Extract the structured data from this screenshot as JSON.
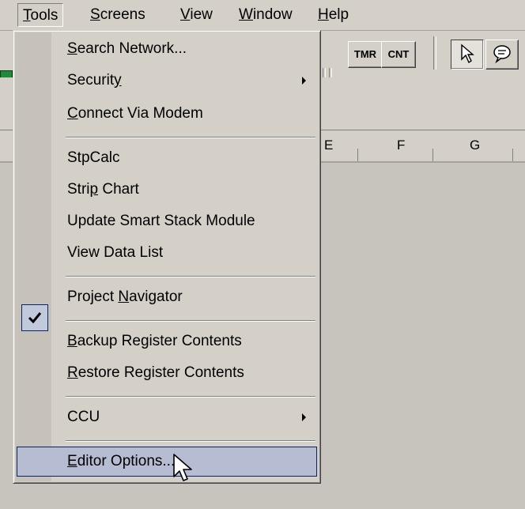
{
  "menubar": {
    "items": [
      {
        "pre": "",
        "u": "T",
        "post": "ools"
      },
      {
        "pre": "",
        "u": "S",
        "post": "creens"
      },
      {
        "pre": "",
        "u": "V",
        "post": "iew"
      },
      {
        "pre": "",
        "u": "W",
        "post": "indow"
      },
      {
        "pre": "",
        "u": "H",
        "post": "elp"
      }
    ]
  },
  "toolbar": {
    "tmr_label": "TMR",
    "cnt_label": "CNT"
  },
  "columns": [
    "E",
    "F",
    "G"
  ],
  "tools_menu": {
    "search_network": {
      "pre": "",
      "u": "S",
      "post": "earch Network..."
    },
    "security": {
      "pre": "Securit",
      "u": "y",
      "post": ""
    },
    "connect_modem": {
      "pre": "",
      "u": "C",
      "post": "onnect Via Modem"
    },
    "stpcalc": {
      "pre": "StpCalc",
      "u": "",
      "post": ""
    },
    "strip_chart": {
      "pre": "Stri",
      "u": "p",
      "post": " Chart"
    },
    "update_smart_stack": {
      "pre": "Update Smart Stack Module",
      "u": "",
      "post": ""
    },
    "view_data_list": {
      "pre": "View Data List",
      "u": "",
      "post": ""
    },
    "project_navigator": {
      "pre": "Project ",
      "u": "N",
      "post": "avigator"
    },
    "backup_register": {
      "pre": "",
      "u": "B",
      "post": "ackup Register Contents"
    },
    "restore_register": {
      "pre": "",
      "u": "R",
      "post": "estore Register Contents"
    },
    "ccu": {
      "pre": "CCU",
      "u": "",
      "post": ""
    },
    "editor_options": {
      "pre": "",
      "u": "E",
      "post": "ditor Options..."
    }
  },
  "colors": {
    "menu_face": "#d4d0c8",
    "highlight": "#b6bdd2",
    "highlight_border": "#0a246a"
  },
  "icons": {
    "checkmark": "check-icon",
    "submenu": "submenu-arrow-icon",
    "pointer": "mouse-pointer-icon",
    "chat": "comment-icon"
  }
}
